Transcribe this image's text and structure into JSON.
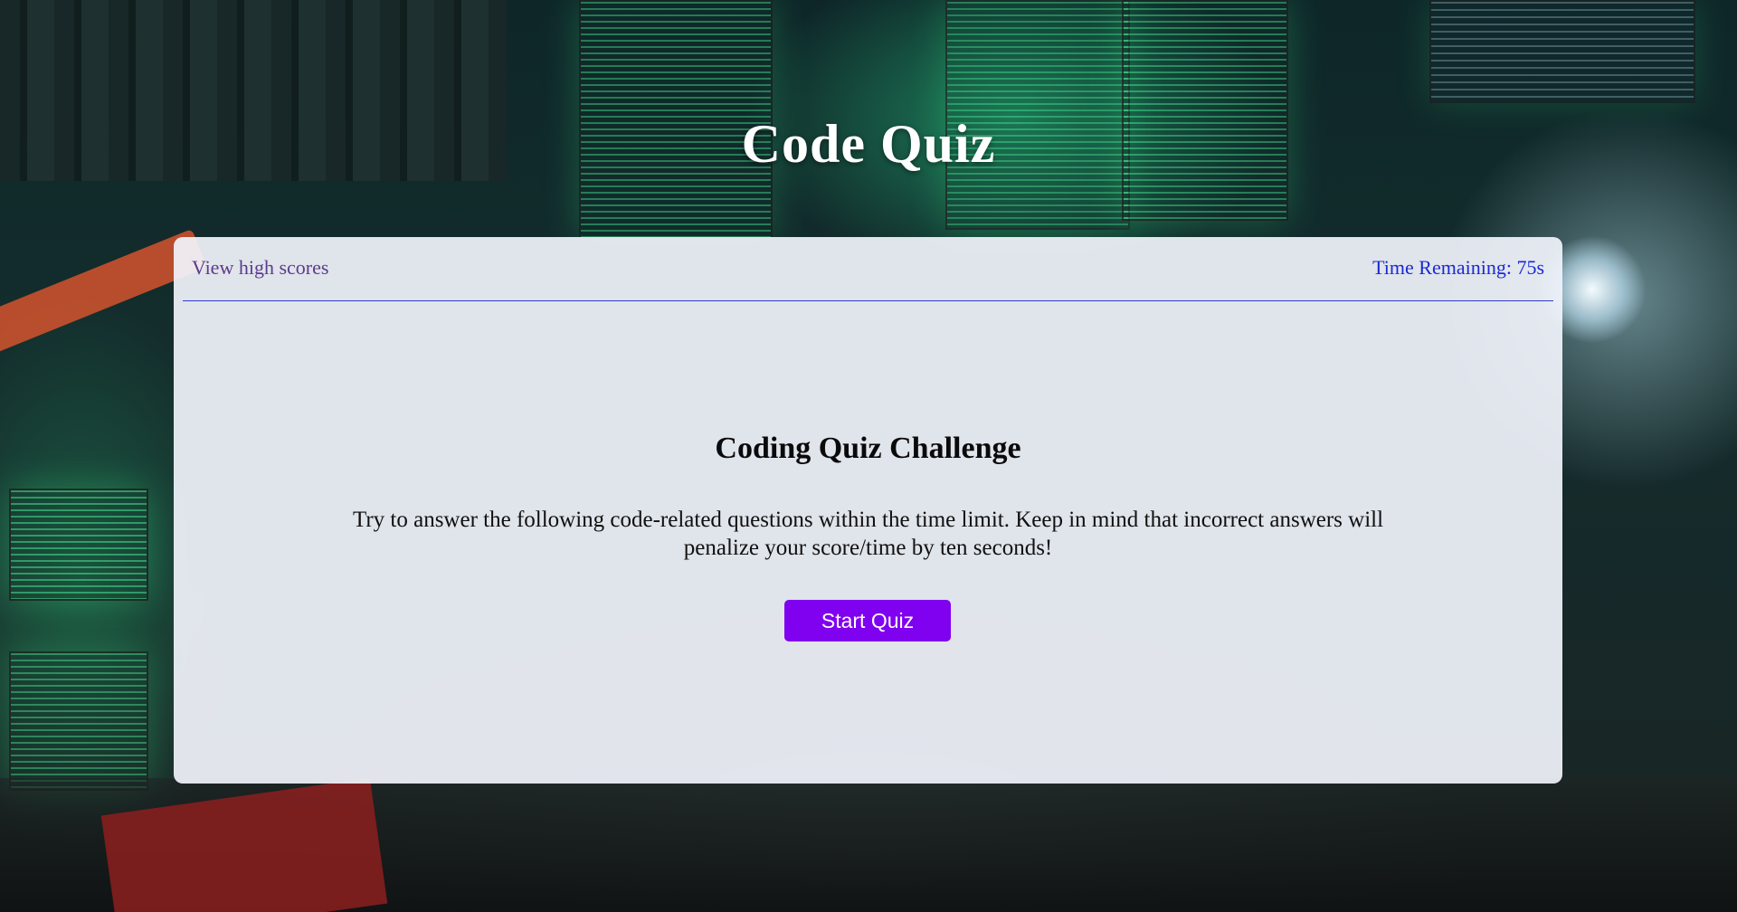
{
  "site": {
    "title": "Code Quiz"
  },
  "header": {
    "high_scores_label": "View high scores",
    "timer_label": "Time Remaining: ",
    "timer_value": "75"
  },
  "intro": {
    "title": "Coding Quiz Challenge",
    "description": "Try to answer the following code-related questions within the time limit. Keep in mind that incorrect answers will penalize your score/time by ten seconds!",
    "start_button_label": "Start Quiz"
  },
  "colors": {
    "accent": "#8000f0",
    "timer_text": "#1a2ad0",
    "link_text": "#5b3b8c",
    "divider": "#2f3acb"
  }
}
